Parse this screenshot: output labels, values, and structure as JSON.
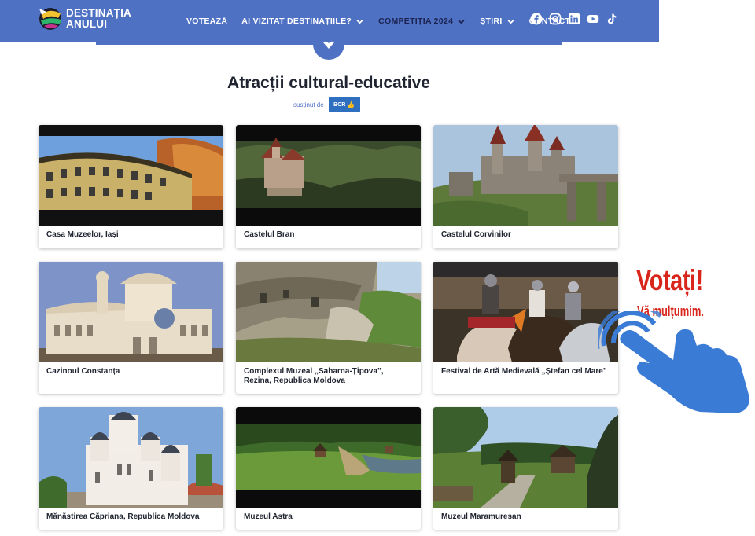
{
  "brand": {
    "line1": "DESTINAȚIA",
    "line2": "ANULUI"
  },
  "nav": [
    {
      "label": "VOTEAZĂ",
      "dropdown": false,
      "active": false
    },
    {
      "label": "AI VIZITAT DESTINAȚIILE?",
      "dropdown": true,
      "active": false
    },
    {
      "label": "COMPETIȚIA 2024",
      "dropdown": true,
      "active": true
    },
    {
      "label": "ȘTIRI",
      "dropdown": true,
      "active": false
    },
    {
      "label": "CONTACT",
      "dropdown": false,
      "active": false
    }
  ],
  "socials": [
    "facebook-icon",
    "instagram-icon",
    "linkedin-icon",
    "youtube-icon",
    "tiktok-icon"
  ],
  "section": {
    "title": "Atracții cultural-educative",
    "sponsor_label": "susținut de",
    "sponsor_badge": "BCR"
  },
  "cards": [
    {
      "caption": "Casa Muzeelor, Iași"
    },
    {
      "caption": "Castelul Bran"
    },
    {
      "caption": "Castelul Corvinilor"
    },
    {
      "caption": "Cazinoul Constanța"
    },
    {
      "caption": "Complexul Muzeal „Saharna-Țipova\", Rezina, Republica Moldova"
    },
    {
      "caption": "Festival de Artă Medievală „Ștefan cel Mare\""
    },
    {
      "caption": "Mănăstirea Căpriana, Republica Moldova"
    },
    {
      "caption": "Muzeul Astra"
    },
    {
      "caption": "Muzeul Maramureșan"
    }
  ],
  "cta": {
    "line1": "Votați!",
    "line2": "Vă mulțumim."
  },
  "colors": {
    "header": "#4f71c4",
    "cta": "#d9261c",
    "hand": "#3a7bd5"
  }
}
